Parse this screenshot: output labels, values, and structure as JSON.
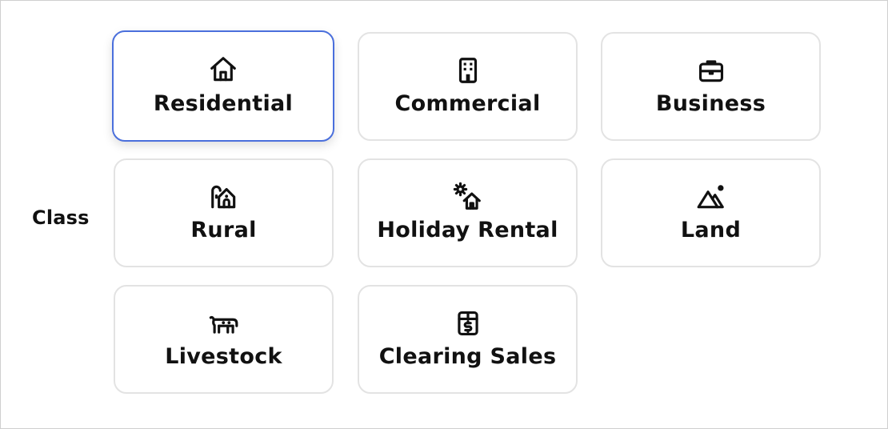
{
  "field_label": "Class",
  "selected_index": 0,
  "colors": {
    "selected_border": "#4a6fdc",
    "card_border": "#e3e3e3",
    "text": "#111111"
  },
  "options": [
    {
      "label": "Residential",
      "icon": "house-icon"
    },
    {
      "label": "Commercial",
      "icon": "building-icon"
    },
    {
      "label": "Business",
      "icon": "briefcase-icon"
    },
    {
      "label": "Rural",
      "icon": "barn-icon"
    },
    {
      "label": "Holiday Rental",
      "icon": "sun-house-icon"
    },
    {
      "label": "Land",
      "icon": "mountain-icon"
    },
    {
      "label": "Livestock",
      "icon": "cow-icon"
    },
    {
      "label": "Clearing Sales",
      "icon": "dollar-box-icon"
    }
  ]
}
